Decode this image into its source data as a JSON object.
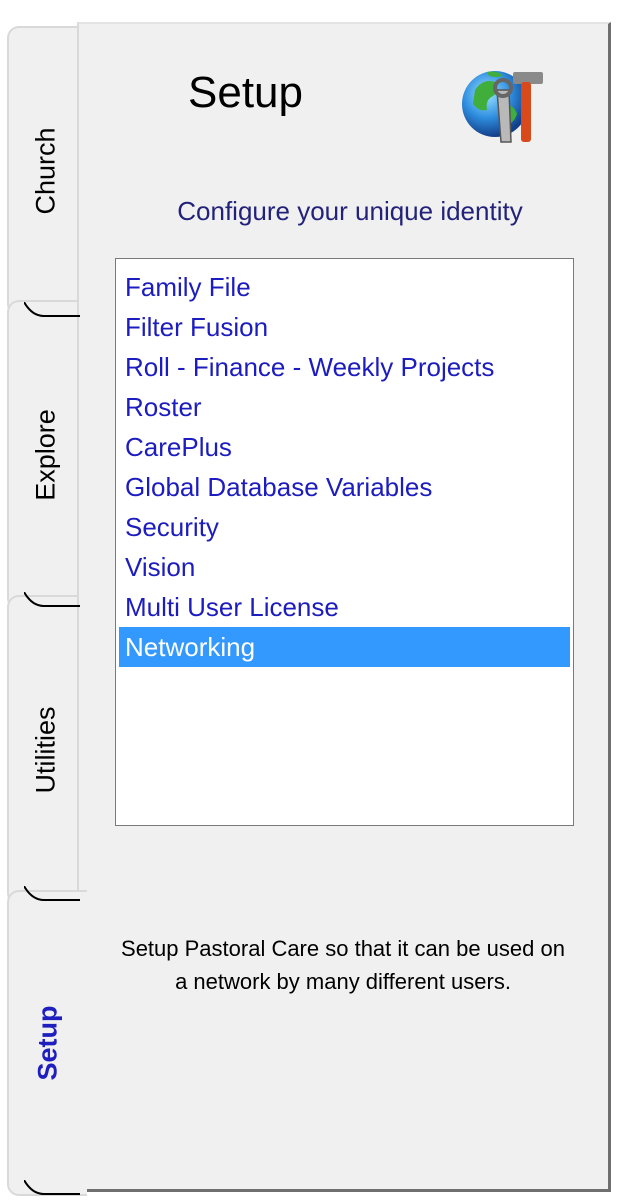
{
  "tabs": [
    {
      "label": "Church",
      "active": false
    },
    {
      "label": "Explore",
      "active": false
    },
    {
      "label": "Utilities",
      "active": false
    },
    {
      "label": "Setup",
      "active": true
    }
  ],
  "header": {
    "title": "Setup",
    "icon": "globe-wrench-hammer-icon",
    "subtitle": "Configure your unique identity"
  },
  "list": {
    "items": [
      "Family File",
      "Filter Fusion",
      "Roll - Finance - Weekly Projects",
      "Roster",
      "CarePlus",
      "Global Database Variables",
      "Security",
      "Vision",
      "Multi User License",
      "Networking"
    ],
    "selected": "Networking"
  },
  "description": "Setup Pastoral Care so that it can be used on a network by many different users.",
  "colors": {
    "panel_bg": "#f0f0f0",
    "list_text": "#1c1cbf",
    "selection": "#3399ff",
    "active_tab_text": "#1f1fbf"
  }
}
